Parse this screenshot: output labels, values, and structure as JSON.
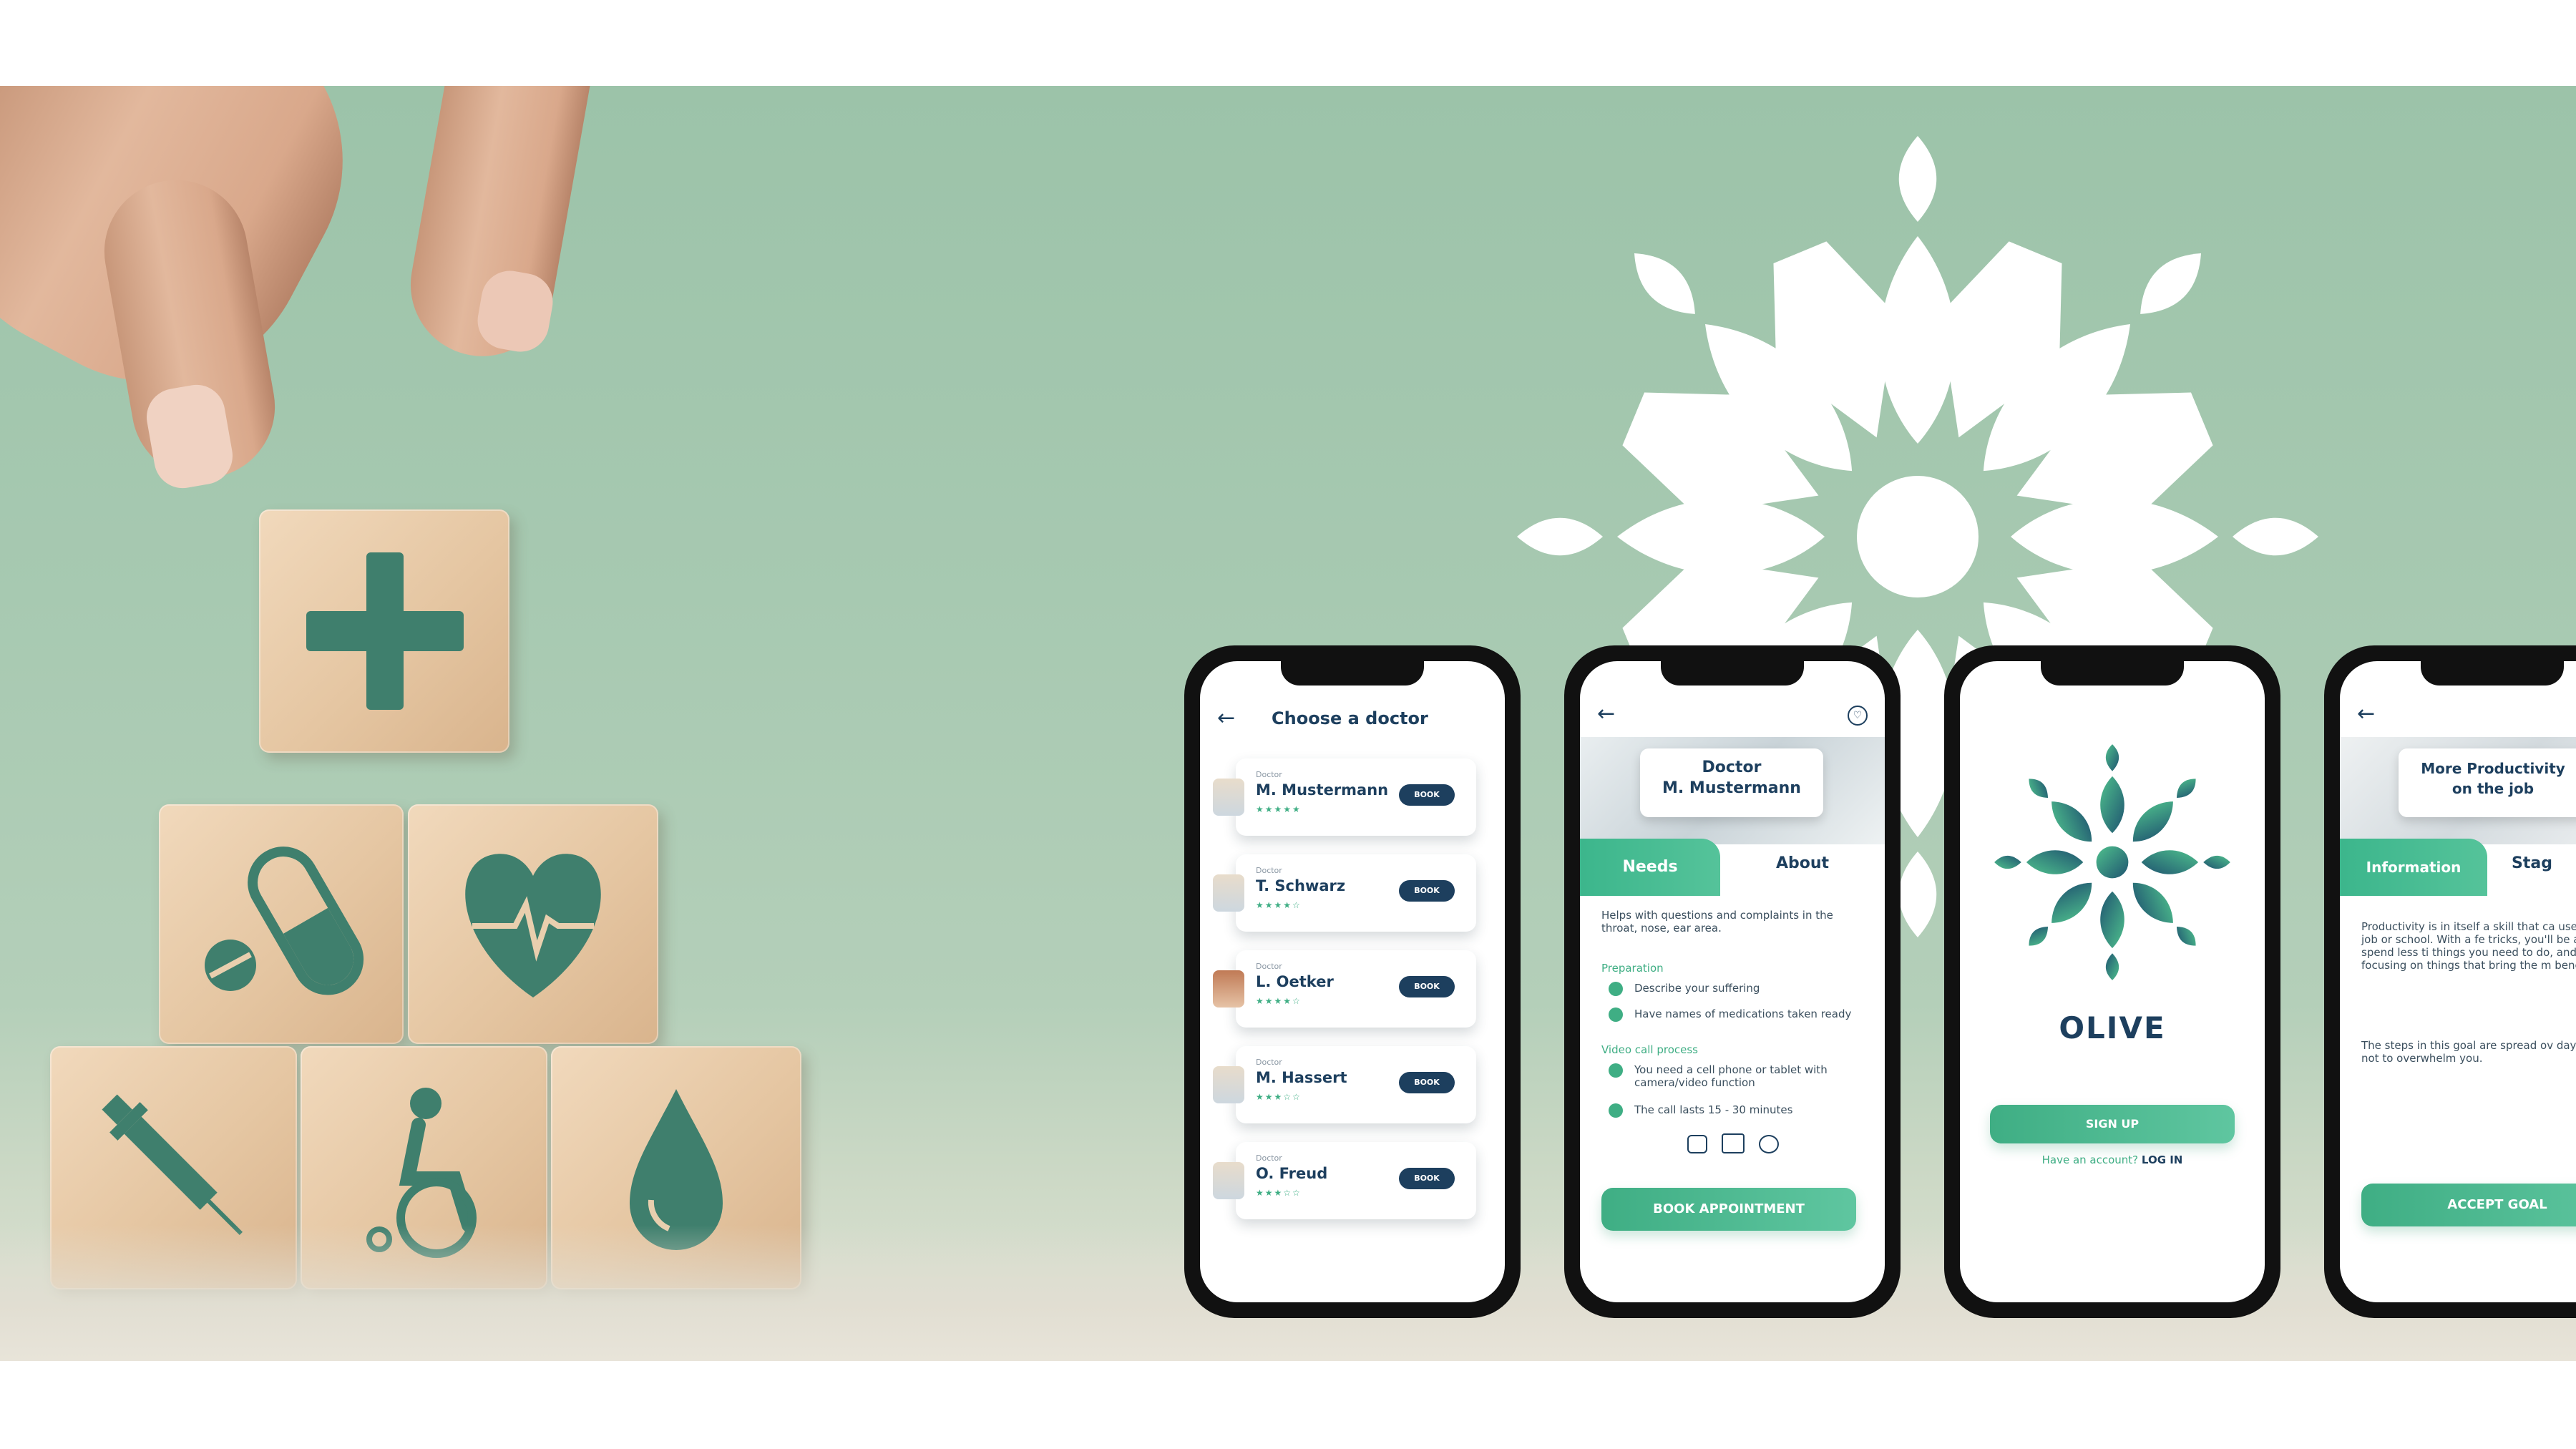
{
  "colors": {
    "background_green": "#a7c9b1",
    "navy": "#1d3f5e",
    "accent_green": "#3fae84",
    "flower_white": "#ffffff"
  },
  "blocks": {
    "icons": [
      "plus-icon",
      "pill-icon",
      "heart-pulse-icon",
      "syringe-icon",
      "wheelchair-icon",
      "drop-icon"
    ]
  },
  "screen1": {
    "title": "Choose a doctor",
    "doctors": [
      {
        "label": "Doctor",
        "name": "M. Mustermann",
        "stars": "★★★★★",
        "button": "BOOK"
      },
      {
        "label": "Doctor",
        "name": "T. Schwarz",
        "stars": "★★★★☆",
        "button": "BOOK"
      },
      {
        "label": "Doctor",
        "name": "L. Oetker",
        "stars": "★★★★☆",
        "button": "BOOK"
      },
      {
        "label": "Doctor",
        "name": "M. Hassert",
        "stars": "★★★☆☆",
        "button": "BOOK"
      },
      {
        "label": "Doctor",
        "name": "O. Freud",
        "stars": "★★★☆☆",
        "button": "BOOK"
      }
    ]
  },
  "screen2": {
    "card_line1": "Doctor",
    "card_line2": "M. Mustermann",
    "tab_needs": "Needs",
    "tab_about": "About",
    "description": "Helps with questions and complaints in the throat, nose, ear area.",
    "preparation_heading": "Preparation",
    "preparation_items": [
      "Describe your suffering",
      "Have names of medications taken ready"
    ],
    "video_heading": "Video call process",
    "video_items": [
      "You need a cell phone or tablet with camera/video function",
      "The call lasts 15 - 30 minutes"
    ],
    "button": "BOOK APPOINTMENT"
  },
  "screen3": {
    "brand": "OLIVE",
    "signup_button": "SIGN UP",
    "account_prompt": "Have an account?",
    "login_link": "LOG IN"
  },
  "screen4": {
    "card_line1": "More Productivity",
    "card_line2": "on the job",
    "tab_information": "Information",
    "tab_stages": "Stag",
    "paragraph1": "Productivity is in itself a skill that ca used in any job or school. With a fe tricks, you'll be able to spend less ti things you need to do, and more tim focusing on things that bring the m benefit.",
    "paragraph2": "The steps in this goal are spread ov days so as not to overwhelm you.",
    "button": "ACCEPT GOAL"
  }
}
